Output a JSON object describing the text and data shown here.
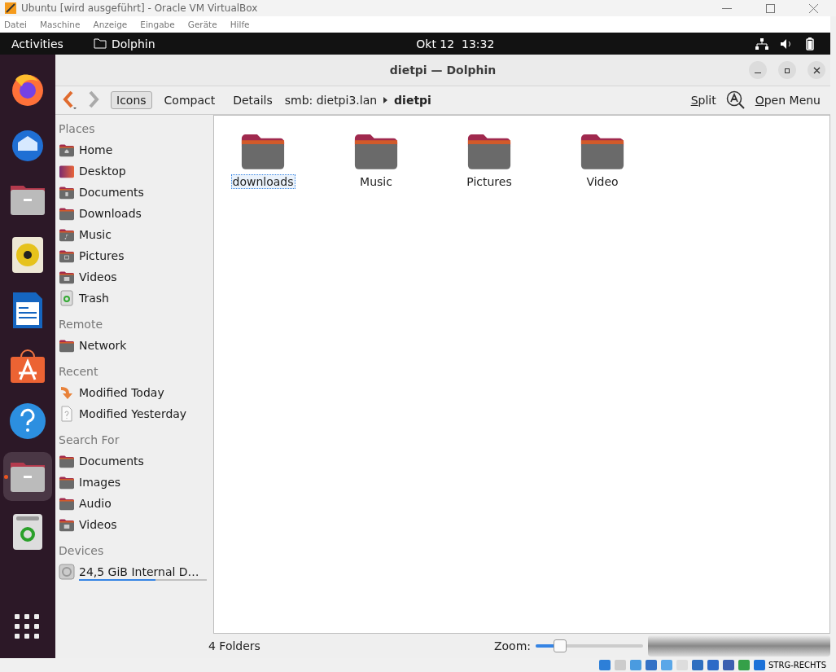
{
  "vbox": {
    "title": "Ubuntu [wird ausgeführt] - Oracle VM VirtualBox",
    "menu": [
      "Datei",
      "Maschine",
      "Anzeige",
      "Eingabe",
      "Geräte",
      "Hilfe"
    ],
    "host_key": "STRG-RECHTS"
  },
  "topbar": {
    "activities": "Activities",
    "app": "Dolphin",
    "clock": "Okt 12  13:32"
  },
  "dock": [
    {
      "kind": "firefox",
      "running": false
    },
    {
      "kind": "thunderbird",
      "running": false
    },
    {
      "kind": "files",
      "running": false
    },
    {
      "kind": "speaker",
      "running": false
    },
    {
      "kind": "writer",
      "running": false
    },
    {
      "kind": "store",
      "running": false
    },
    {
      "kind": "help",
      "running": false
    },
    {
      "kind": "files",
      "running": true
    },
    {
      "kind": "trash",
      "running": false
    }
  ],
  "window": {
    "title": "dietpi — Dolphin"
  },
  "toolbar": {
    "view_modes": [
      {
        "label": "Icons",
        "selected": true
      },
      {
        "label": "Compact",
        "selected": false
      },
      {
        "label": "Details",
        "selected": false
      }
    ],
    "breadcrumb": [
      "smb: dietpi3.lan",
      "dietpi"
    ],
    "split": "Split",
    "open_menu": "Open Menu"
  },
  "sidebar": [
    {
      "heading": "Places",
      "items": [
        {
          "label": "Home",
          "kind": "home"
        },
        {
          "label": "Desktop",
          "kind": "desktop"
        },
        {
          "label": "Documents",
          "kind": "doc"
        },
        {
          "label": "Downloads",
          "kind": "folder"
        },
        {
          "label": "Music",
          "kind": "music"
        },
        {
          "label": "Pictures",
          "kind": "pictures"
        },
        {
          "label": "Videos",
          "kind": "video"
        },
        {
          "label": "Trash",
          "kind": "trash"
        }
      ]
    },
    {
      "heading": "Remote",
      "items": [
        {
          "label": "Network",
          "kind": "folder"
        }
      ]
    },
    {
      "heading": "Recent",
      "items": [
        {
          "label": "Modified Today",
          "kind": "today"
        },
        {
          "label": "Modified Yesterday",
          "kind": "unknown"
        }
      ]
    },
    {
      "heading": "Search For",
      "items": [
        {
          "label": "Documents",
          "kind": "folder"
        },
        {
          "label": "Images",
          "kind": "folder"
        },
        {
          "label": "Audio",
          "kind": "folder"
        },
        {
          "label": "Videos",
          "kind": "video"
        }
      ]
    },
    {
      "heading": "Devices",
      "items": [
        {
          "label": "24,5 GiB Internal D…",
          "kind": "disk",
          "level": 0.6
        }
      ]
    }
  ],
  "folders": [
    {
      "name": "downloads",
      "selected": true
    },
    {
      "name": "Music",
      "selected": false
    },
    {
      "name": "Pictures",
      "selected": false
    },
    {
      "name": "Video",
      "selected": false
    }
  ],
  "status": {
    "summary": "4 Folders",
    "zoom_label": "Zoom:",
    "zoom": {
      "level": 0.22
    }
  }
}
